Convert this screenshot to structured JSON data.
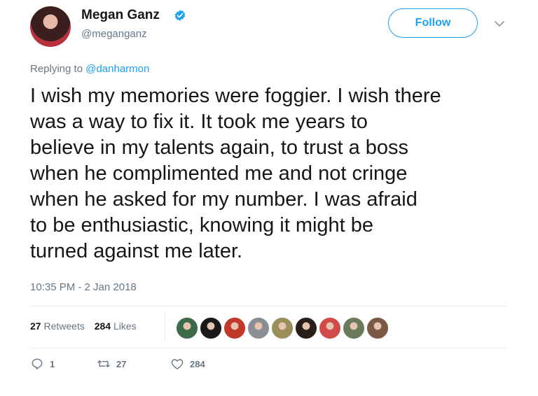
{
  "author": {
    "name": "Megan Ganz",
    "handle": "@meganganz",
    "verified": true
  },
  "follow_label": "Follow",
  "reply_context": {
    "prefix": "Replying to",
    "target": "@danharmon"
  },
  "tweet_text": "I wish my memories were foggier. I wish there\nwas a way to fix it. It took me years to\nbelieve in my talents again, to trust a boss\nwhen he complimented me and not cringe\nwhen he asked for my number. I was afraid\nto be enthusiastic, knowing it might be\nturned against me later.",
  "timestamp": "10:35 PM - 2 Jan 2018",
  "stats": {
    "retweets_count": "27",
    "retweets_label": "Retweets",
    "likes_count": "284",
    "likes_label": "Likes"
  },
  "liker_avatars": [
    {
      "icon": "liker-avatar",
      "color": "#3d6b4a"
    },
    {
      "icon": "liker-avatar",
      "color": "#1a1a1a"
    },
    {
      "icon": "liker-avatar",
      "color": "#c0392b"
    },
    {
      "icon": "liker-avatar",
      "color": "#8a8f96"
    },
    {
      "icon": "liker-avatar",
      "color": "#9a8f5a"
    },
    {
      "icon": "liker-avatar",
      "color": "#2a1e1a"
    },
    {
      "icon": "liker-avatar",
      "color": "#d24b4b"
    },
    {
      "icon": "liker-avatar",
      "color": "#6b7a5a"
    },
    {
      "icon": "liker-avatar",
      "color": "#7a5a45"
    }
  ],
  "actions": {
    "replies": "1",
    "retweets": "27",
    "likes": "284"
  },
  "colors": {
    "accent": "#1da1f2",
    "text": "#14171a",
    "muted": "#657786",
    "divider": "#e6ecf0"
  }
}
